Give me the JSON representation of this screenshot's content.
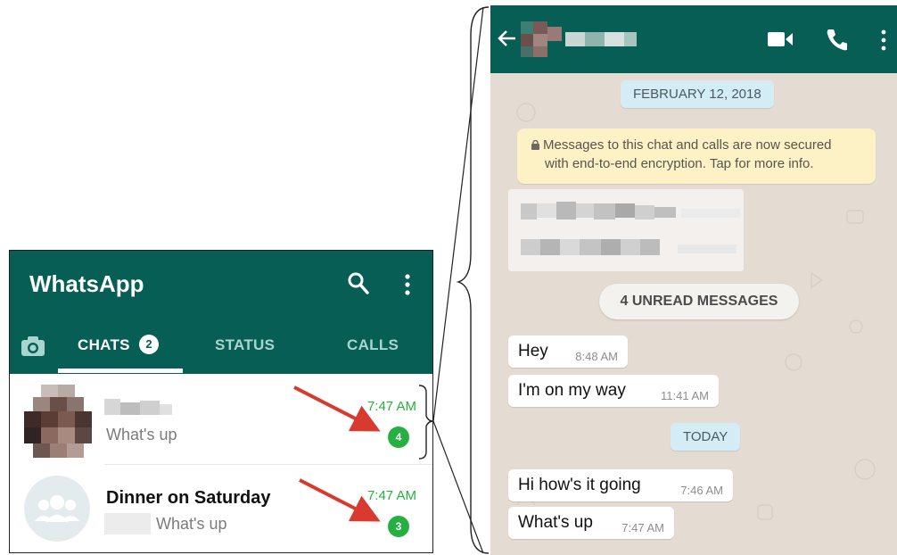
{
  "chat_list": {
    "app_title": "WhatsApp",
    "icons": {
      "search": "search-icon",
      "menu": "more-vert-icon",
      "camera": "camera-icon"
    },
    "tabs": [
      {
        "label": "CHATS",
        "badge": "2",
        "active": true
      },
      {
        "label": "STATUS",
        "active": false
      },
      {
        "label": "CALLS",
        "active": false
      }
    ],
    "chats": [
      {
        "name": "",
        "last_message": "What's up",
        "time": "7:47 AM",
        "unread": "4"
      },
      {
        "name": "Dinner on Saturday",
        "last_message": "What's up",
        "time": "7:47 AM",
        "unread": "3"
      }
    ]
  },
  "conversation": {
    "contact_name": "",
    "icons": {
      "back": "back-arrow-icon",
      "video": "video-call-icon",
      "call": "phone-icon",
      "menu": "more-vert-icon",
      "lock": "lock-icon"
    },
    "date_1": "FEBRUARY 12, 2018",
    "encryption_notice_line1": "Messages to this chat and calls are now secured",
    "encryption_notice_line2": "with end-to-end encryption. Tap for more info.",
    "unread_separator": "4 UNREAD MESSAGES",
    "messages_a": [
      {
        "text": "Hey",
        "time": "8:48 AM"
      },
      {
        "text": "I'm on my way",
        "time": "11:41 AM"
      }
    ],
    "date_2": "TODAY",
    "messages_b": [
      {
        "text": "Hi how's it going",
        "time": "7:46 AM"
      },
      {
        "text": "What's up",
        "time": "7:47 AM"
      }
    ]
  },
  "colors": {
    "header_green": "#075e54",
    "unread_green": "#25b041",
    "annotation_red": "#d93a2f",
    "chat_background": "#e4dcd2"
  }
}
